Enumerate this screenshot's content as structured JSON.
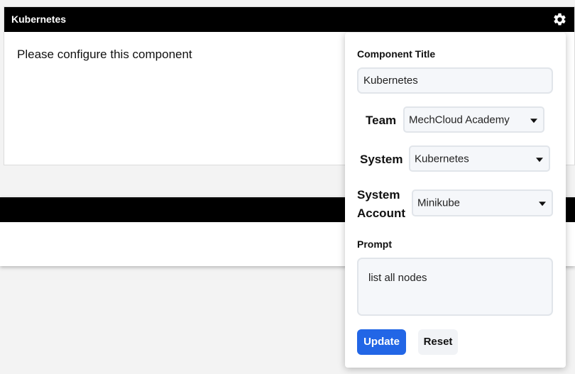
{
  "card1": {
    "title": "Kubernetes",
    "message": "Please configure this component",
    "settings_icon": "gear-icon"
  },
  "panel": {
    "component_title_label": "Component Title",
    "component_title_value": "Kubernetes",
    "team_label": "Team",
    "team_value": "MechCloud Academy",
    "system_label": "System",
    "system_value": "Kubernetes",
    "system_account_label_line1": "System",
    "system_account_label_line2": "Account",
    "system_account_value": "Minikube",
    "prompt_label": "Prompt",
    "prompt_value": "list all nodes",
    "update_label": "Update",
    "reset_label": "Reset"
  },
  "colors": {
    "header_bg": "#000000",
    "primary_button": "#2266e6",
    "page_bg": "#f3f3f3"
  }
}
